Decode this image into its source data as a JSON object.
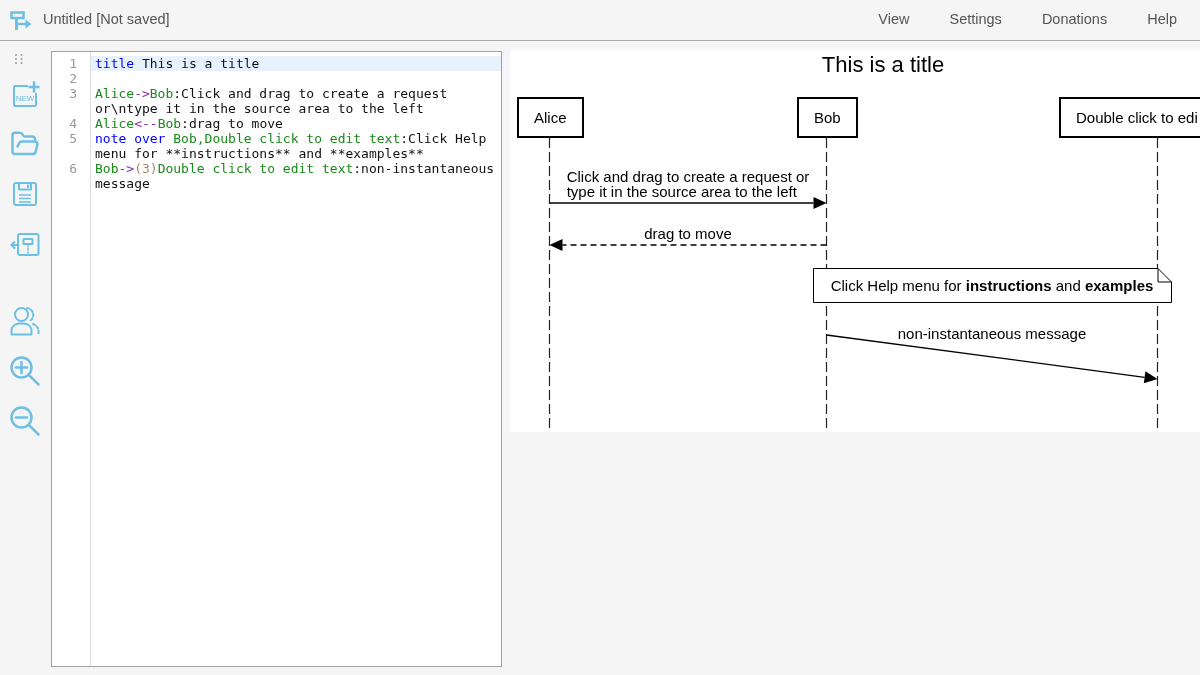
{
  "app": {
    "title": "Untitled [Not saved]"
  },
  "menu": [
    {
      "label": "View"
    },
    {
      "label": "Settings"
    },
    {
      "label": "Donations"
    },
    {
      "label": "Help"
    }
  ],
  "toolbar": {
    "new_button": {
      "label": "NEW"
    }
  },
  "editor": {
    "lines": [
      {
        "number": "1",
        "highlighted": true,
        "tokens": [
          {
            "kind": "keyword",
            "text": "title"
          },
          {
            "kind": "text",
            "text": " This is a title"
          }
        ]
      },
      {
        "number": "2",
        "highlighted": false
      },
      {
        "number": "3",
        "highlighted": false,
        "tokens": [
          {
            "kind": "name",
            "text": "Alice"
          },
          {
            "kind": "arrow",
            "text": "->"
          },
          {
            "kind": "name",
            "text": "Bob"
          },
          {
            "kind": "text",
            "text": ":Click and drag to create a request or\\ntype it in the source area to the left"
          }
        ]
      },
      {
        "number": "4",
        "highlighted": false,
        "tokens": [
          {
            "kind": "name",
            "text": "Alice"
          },
          {
            "kind": "arrow",
            "text": "<--"
          },
          {
            "kind": "name",
            "text": "Bob"
          },
          {
            "kind": "text",
            "text": ":drag to move"
          }
        ]
      },
      {
        "number": "5",
        "highlighted": false,
        "tokens": [
          {
            "kind": "keyword",
            "text": "note"
          },
          {
            "kind": "keyword",
            "text": " over"
          },
          {
            "kind": "name",
            "text": " Bob,Double click to edit text"
          },
          {
            "kind": "text",
            "text": ":Click Help menu for **instructions** and **examples**"
          }
        ]
      },
      {
        "number": "6",
        "highlighted": false,
        "tokens": [
          {
            "kind": "name",
            "text": "Bob"
          },
          {
            "kind": "arrow",
            "text": "->"
          },
          {
            "kind": "delay",
            "text": "(3)"
          },
          {
            "kind": "name",
            "text": "Double click to edit text"
          },
          {
            "kind": "text",
            "text": ":non-instantaneous message"
          }
        ]
      }
    ]
  },
  "diagram": {
    "title": "This is a title",
    "participants": [
      {
        "label": "Alice"
      },
      {
        "label": "Bob"
      },
      {
        "label": "Double click to edi"
      }
    ],
    "messages": [
      {
        "kind": "solid",
        "leftward": false,
        "label": "Click and drag to create a request or\ntype it in the source area to the left"
      },
      {
        "kind": "dashed",
        "leftward": true,
        "label": "drag to move"
      },
      {
        "kind": "note",
        "label": "Click Help menu for **instructions** and **examples**"
      },
      {
        "kind": "delayed",
        "leftward": false,
        "label": "non-instantaneous message"
      }
    ]
  }
}
